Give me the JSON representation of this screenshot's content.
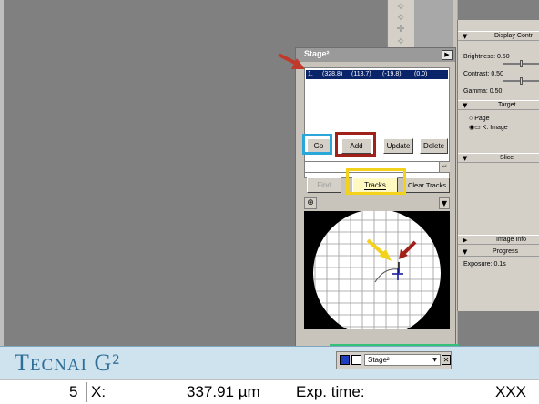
{
  "toolbar_glyphs": [
    "✧",
    "✧",
    "✛",
    "✧"
  ],
  "panels": {
    "display_control": {
      "header": "Display Contr",
      "brightness": "Brightness: 0.50",
      "contrast": "Contrast: 0.50",
      "gamma": "Gamma: 0.50"
    },
    "target": {
      "header": "Target",
      "page_option": "Page",
      "image_option": "K: Image"
    },
    "slice": {
      "header": "Slice"
    },
    "image_info": {
      "header": "Image Info"
    },
    "progress": {
      "header": "Progress",
      "exposure": "Exposure: 0.1s"
    }
  },
  "stage_window": {
    "title": "Stage²",
    "position_row": {
      "index": "1.",
      "x": "(328.8)",
      "y": "(118.7)",
      "z": "(-19.8)",
      "a": "(0.0)"
    },
    "buttons": {
      "go": "Go",
      "add": "Add",
      "update": "Update",
      "delete": "Delete",
      "find": "Find",
      "tracks": "Tracks",
      "clear_tracks": "Clear Tracks"
    },
    "command_value": "",
    "enter_glyph": "↵",
    "zoom_glyph": "⊕",
    "map_menu_glyph": "▼"
  },
  "tecnai": {
    "logo_text": "T",
    "logo_small": "ECNAI",
    "logo_suffix": " G²"
  },
  "taskbar": {
    "selected_window": "Stage²",
    "dropdown_glyph": "▼",
    "close_glyph": "✕"
  },
  "status": {
    "number": "5",
    "axis": "X:",
    "value": "337.91 µm",
    "exp_label": "Exp. time:",
    "exp_value": "XXX"
  },
  "annotation_colors": {
    "red": "#c0392b",
    "blue": "#2aa7d8",
    "yellow": "#f2d21b",
    "green": "#35c07a",
    "dark_red": "#a0201a"
  },
  "colors": {
    "list_selection": "#0a246a",
    "map_cross": "#1a1aa0",
    "tecnai_brand": "#2f6f97"
  }
}
